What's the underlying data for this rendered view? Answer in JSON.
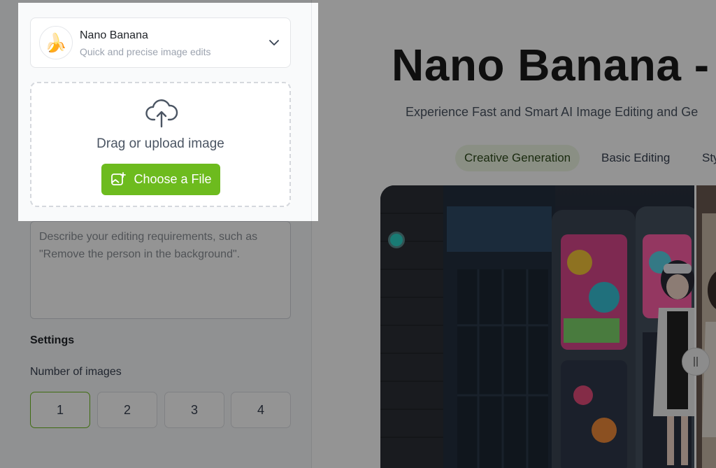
{
  "model": {
    "name": "Nano Banana",
    "subtitle": "Quick and precise image edits",
    "emoji": "🍌"
  },
  "upload": {
    "label": "Drag or upload image",
    "button_label": "Choose a File"
  },
  "prompt": {
    "placeholder": "Describe your editing requirements, such as \"Remove the person in the background\"."
  },
  "settings": {
    "title": "Settings",
    "num_images_label": "Number of images",
    "options": [
      "1",
      "2",
      "3",
      "4"
    ],
    "selected": "1"
  },
  "hero": {
    "title": "Nano Banana - A",
    "subtitle": "Experience Fast and Smart AI Image Editing and Ge"
  },
  "tabs": [
    "Creative Generation",
    "Basic Editing",
    "Sty"
  ],
  "colors": {
    "accent": "#6dbb1e",
    "tab_active_bg": "#eef7e4",
    "overlay": "rgba(0,0,0,0.42)"
  },
  "icons": {
    "model_avatar": "banana-icon",
    "model_dropdown": "chevron-down-icon",
    "upload": "cloud-upload-icon",
    "choose_file": "image-add-icon",
    "compare_handle": "drag-handle-icon"
  }
}
